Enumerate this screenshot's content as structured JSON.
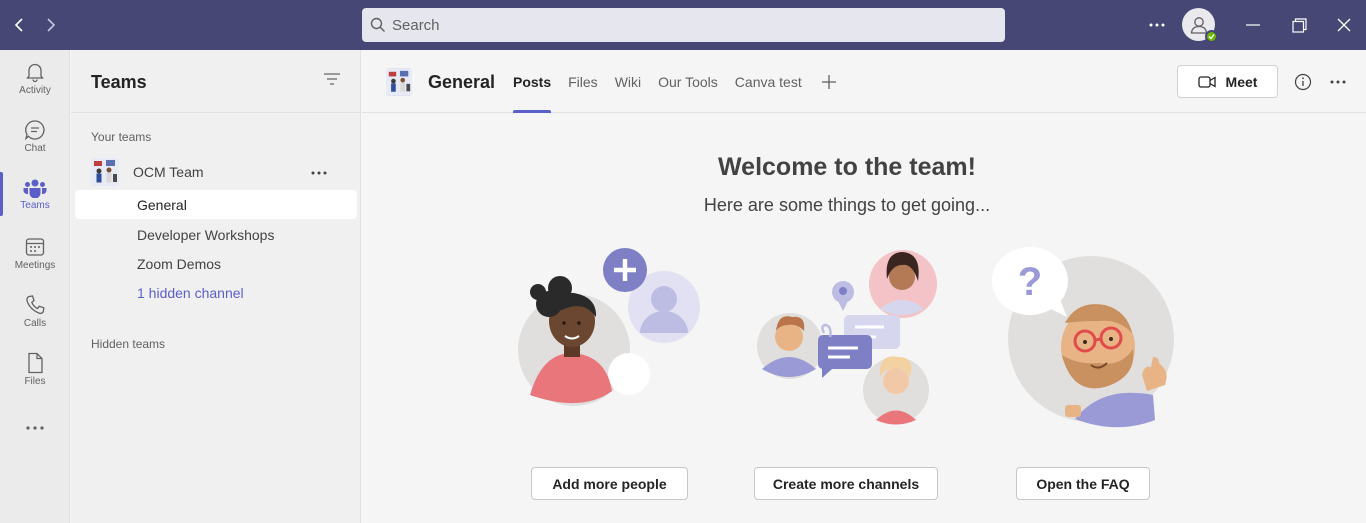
{
  "titlebar": {
    "search_placeholder": "Search"
  },
  "rail": {
    "items": [
      {
        "label": "Activity",
        "icon": "bell-icon"
      },
      {
        "label": "Chat",
        "icon": "chat-icon"
      },
      {
        "label": "Teams",
        "icon": "teams-icon",
        "active": true
      },
      {
        "label": "Meetings",
        "icon": "calendar-icon"
      },
      {
        "label": "Calls",
        "icon": "phone-icon"
      },
      {
        "label": "Files",
        "icon": "file-icon"
      }
    ]
  },
  "teams_pane": {
    "title": "Teams",
    "your_teams_label": "Your teams",
    "team_name": "OCM Team",
    "channels": [
      "General",
      "Developer Workshops",
      "Zoom Demos"
    ],
    "hidden_channel_link": "1 hidden channel",
    "hidden_teams_label": "Hidden teams"
  },
  "main": {
    "channel_title": "General",
    "tabs": [
      "Posts",
      "Files",
      "Wiki",
      "Our Tools",
      "Canva test"
    ],
    "meet_label": "Meet",
    "welcome_title": "Welcome to the team!",
    "welcome_sub": "Here are some things to get going...",
    "actions": [
      "Add more people",
      "Create more channels",
      "Open the FAQ"
    ]
  },
  "colors": {
    "titlebar": "#464775",
    "accent": "#5b5fc7",
    "presence": "#6bb700"
  }
}
